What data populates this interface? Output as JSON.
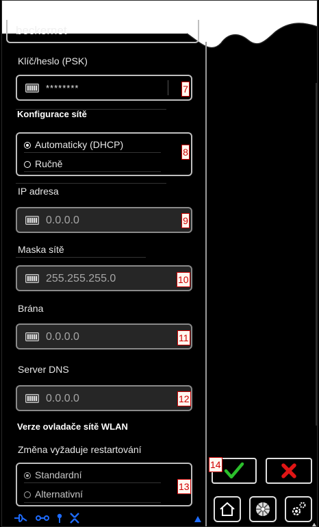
{
  "form": {
    "network_name_value": "beckernet",
    "psk_label": "Klíč/heslo (PSK)",
    "psk_value": "********",
    "psk_badge": "7",
    "net_config_heading": "Konfigurace sítě",
    "net_config_badge": "8",
    "net_config_options": [
      "Automaticky (DHCP)",
      "Ručně"
    ],
    "net_config_selected": "Automaticky (DHCP)",
    "ip_label": "IP adresa",
    "ip_value": "0.0.0.0",
    "ip_badge": "9",
    "mask_label": "Maska sítě",
    "mask_value": "255.255.255.0",
    "mask_badge": "10",
    "gateway_label": "Brána",
    "gateway_value": "0.0.0.0",
    "gateway_badge": "11",
    "dns_label": "Server DNS",
    "dns_value": "0.0.0.0",
    "dns_badge": "12",
    "wlan_heading": "Verze ovladače sítě WLAN",
    "restart_note": "Změna vyžaduje restartování",
    "driver_options": [
      "Standardní",
      "Alternativní"
    ],
    "driver_selected": "Standardní",
    "driver_badge": "13"
  },
  "actions": {
    "confirm_badge": "14",
    "confirm_icon": "checkmark-icon",
    "cancel_icon": "close-x-icon",
    "home_icon": "home-icon",
    "media_icon": "disc-icon",
    "settings_icon": "gears-icon"
  },
  "colors": {
    "confirm_green": "#2bbf2b",
    "cancel_red": "#e01515",
    "badge_red": "#d00000",
    "status_blue": "#1e6cff"
  }
}
